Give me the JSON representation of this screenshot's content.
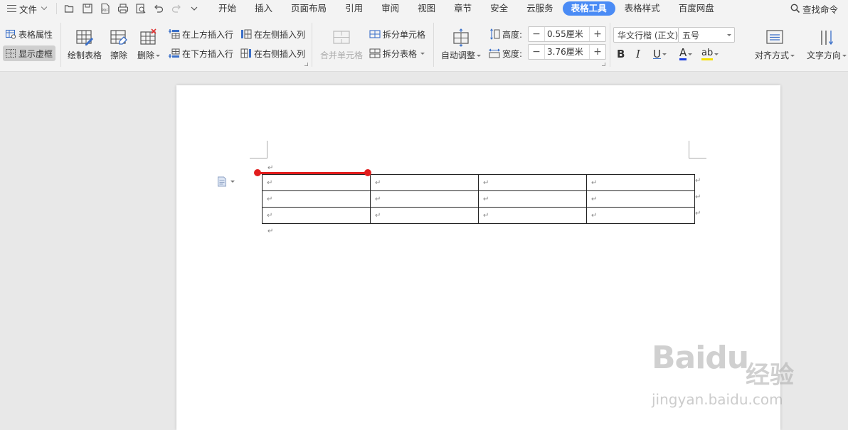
{
  "menubar": {
    "file_label": "文件",
    "quick_access": [
      {
        "name": "open-icon"
      },
      {
        "name": "save-icon"
      },
      {
        "name": "pdf-icon"
      },
      {
        "name": "print-icon"
      },
      {
        "name": "print-preview-icon"
      },
      {
        "name": "undo-icon"
      },
      {
        "name": "redo-icon"
      },
      {
        "name": "customize-icon"
      }
    ],
    "tabs": [
      {
        "label": "开始"
      },
      {
        "label": "插入"
      },
      {
        "label": "页面布局"
      },
      {
        "label": "引用"
      },
      {
        "label": "审阅"
      },
      {
        "label": "视图"
      },
      {
        "label": "章节"
      },
      {
        "label": "安全"
      },
      {
        "label": "云服务"
      },
      {
        "label": "表格工具",
        "active": true
      },
      {
        "label": "表格样式"
      },
      {
        "label": "百度网盘"
      }
    ],
    "search_label": "查找命令"
  },
  "ribbon": {
    "table_properties": "表格属性",
    "show_gridlines": "显示虚框",
    "draw_table": "绘制表格",
    "erase": "擦除",
    "delete": "删除",
    "insert_row_above": "在上方插入行",
    "insert_row_below": "在下方插入行",
    "insert_col_left": "在左侧插入列",
    "insert_col_right": "在右侧插入列",
    "merge_cells": "合并单元格",
    "split_cells": "拆分单元格",
    "split_table": "拆分表格",
    "auto_fit": "自动调整",
    "height_label": "高度:",
    "height_value": "0.55厘米",
    "width_label": "宽度:",
    "width_value": "3.76厘米",
    "font_name": "华文行楷 (正文)",
    "font_size": "五号",
    "bold": "B",
    "italic": "I",
    "underline": "U",
    "font_color": "A",
    "highlight": "ab",
    "align": "对齐方式",
    "text_direction": "文字方向"
  },
  "document": {
    "paragraph_mark": "↵",
    "table_rows": [
      [
        "↵",
        "↵",
        "↵",
        "↵"
      ],
      [
        "↵",
        "↵",
        "↵",
        "↵"
      ],
      [
        "↵",
        "↵",
        "↵",
        "↵"
      ]
    ]
  },
  "watermark": {
    "logo": "Baidu",
    "cn": "经验",
    "url": "jingyan.baidu.com"
  },
  "colors": {
    "accent_blue": "#4a8bf5",
    "annotation_red": "#e21d1d",
    "font_color_bar": "#1a3de0",
    "highlight_bar": "#f5e000"
  }
}
